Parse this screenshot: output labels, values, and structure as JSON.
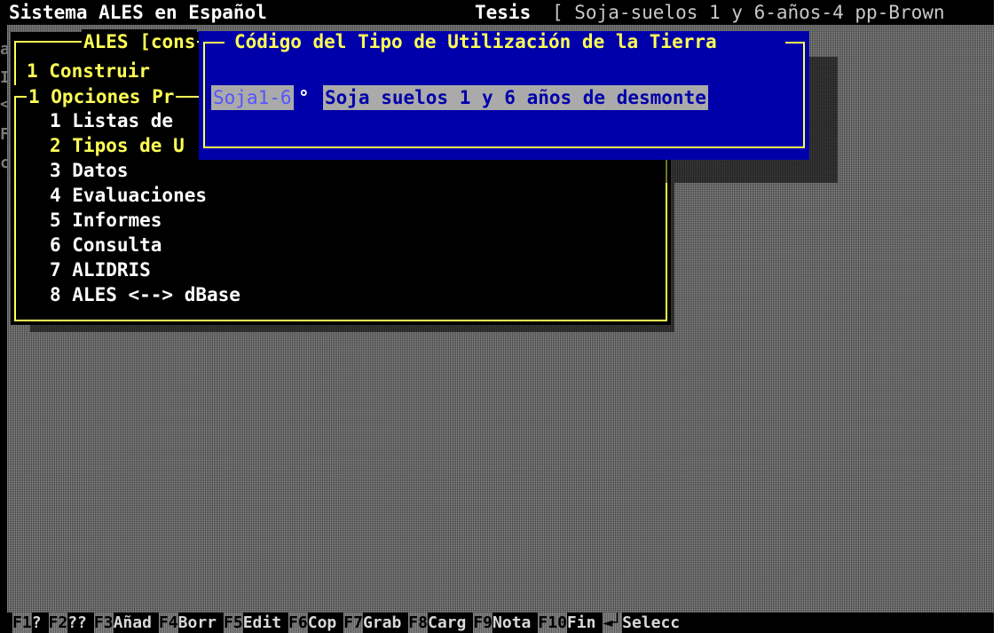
{
  "titlebar": {
    "app_title": "Sistema ALES en Español",
    "context_label": "Tesis",
    "context_value": "[ Soja-suelos 1 y 6-años-4 pp-Brown"
  },
  "left_tags": [
    "a",
    "I",
    "<",
    "F",
    "c"
  ],
  "outer_window": {
    "title": "ALES [cons",
    "item": "1 Construir"
  },
  "options_window": {
    "title": "1 Opciones Pr",
    "items": [
      {
        "label": "1 Listas de",
        "highlighted": false
      },
      {
        "label": "2 Tipos de U",
        "highlighted": true
      },
      {
        "label": "3 Datos",
        "highlighted": false
      },
      {
        "label": "4 Evaluaciones",
        "highlighted": false
      },
      {
        "label": "5 Informes",
        "highlighted": false
      },
      {
        "label": "6 Consulta",
        "highlighted": false
      },
      {
        "label": "7 ALIDRIS",
        "highlighted": false
      },
      {
        "label": "8 ALES <--> dBase",
        "highlighted": false
      }
    ]
  },
  "dialog": {
    "title": "Código del Tipo de Utilización de la Tierra",
    "code_value": "Soja1-6",
    "marker": "°",
    "description_value": "Soja suelos 1 y 6 años de desmonte"
  },
  "function_keys": [
    {
      "key": "F1",
      "label": "?"
    },
    {
      "key": "F2",
      "label": "??"
    },
    {
      "key": "F3",
      "label": "Añad"
    },
    {
      "key": "F4",
      "label": "Borr"
    },
    {
      "key": "F5",
      "label": "Edit"
    },
    {
      "key": "F6",
      "label": "Cop"
    },
    {
      "key": "F7",
      "label": "Grab"
    },
    {
      "key": "F8",
      "label": "Carg"
    },
    {
      "key": "F9",
      "label": "Nota"
    },
    {
      "key": "F10",
      "label": "Fin"
    },
    {
      "key": "◄┘",
      "label": "Selecc"
    }
  ],
  "colors": {
    "dialog_background": "#0000aa",
    "border_yellow": "#ffff55",
    "highlight_yellow": "#ffff55",
    "field_background": "#aaaaaa"
  }
}
